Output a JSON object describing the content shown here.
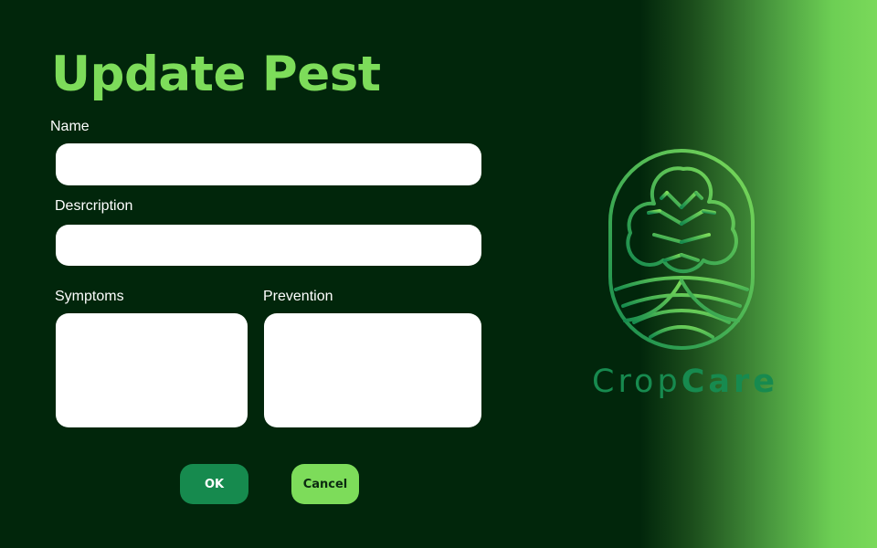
{
  "form": {
    "title": "Update Pest",
    "name_label": "Name",
    "name_value": "",
    "description_label": "Desrcription",
    "description_value": "",
    "symptoms_label": "Symptoms",
    "symptoms_value": "",
    "prevention_label": "Prevention",
    "prevention_value": ""
  },
  "buttons": {
    "ok_label": "OK",
    "cancel_label": "Cancel"
  },
  "brand": {
    "name_light": "Crop",
    "name_bold": "Care",
    "logo_icon": "tree-logo-icon"
  },
  "colors": {
    "background": "#01260b",
    "accent_green": "#7ddc5a",
    "brand_green": "#178a4f"
  }
}
